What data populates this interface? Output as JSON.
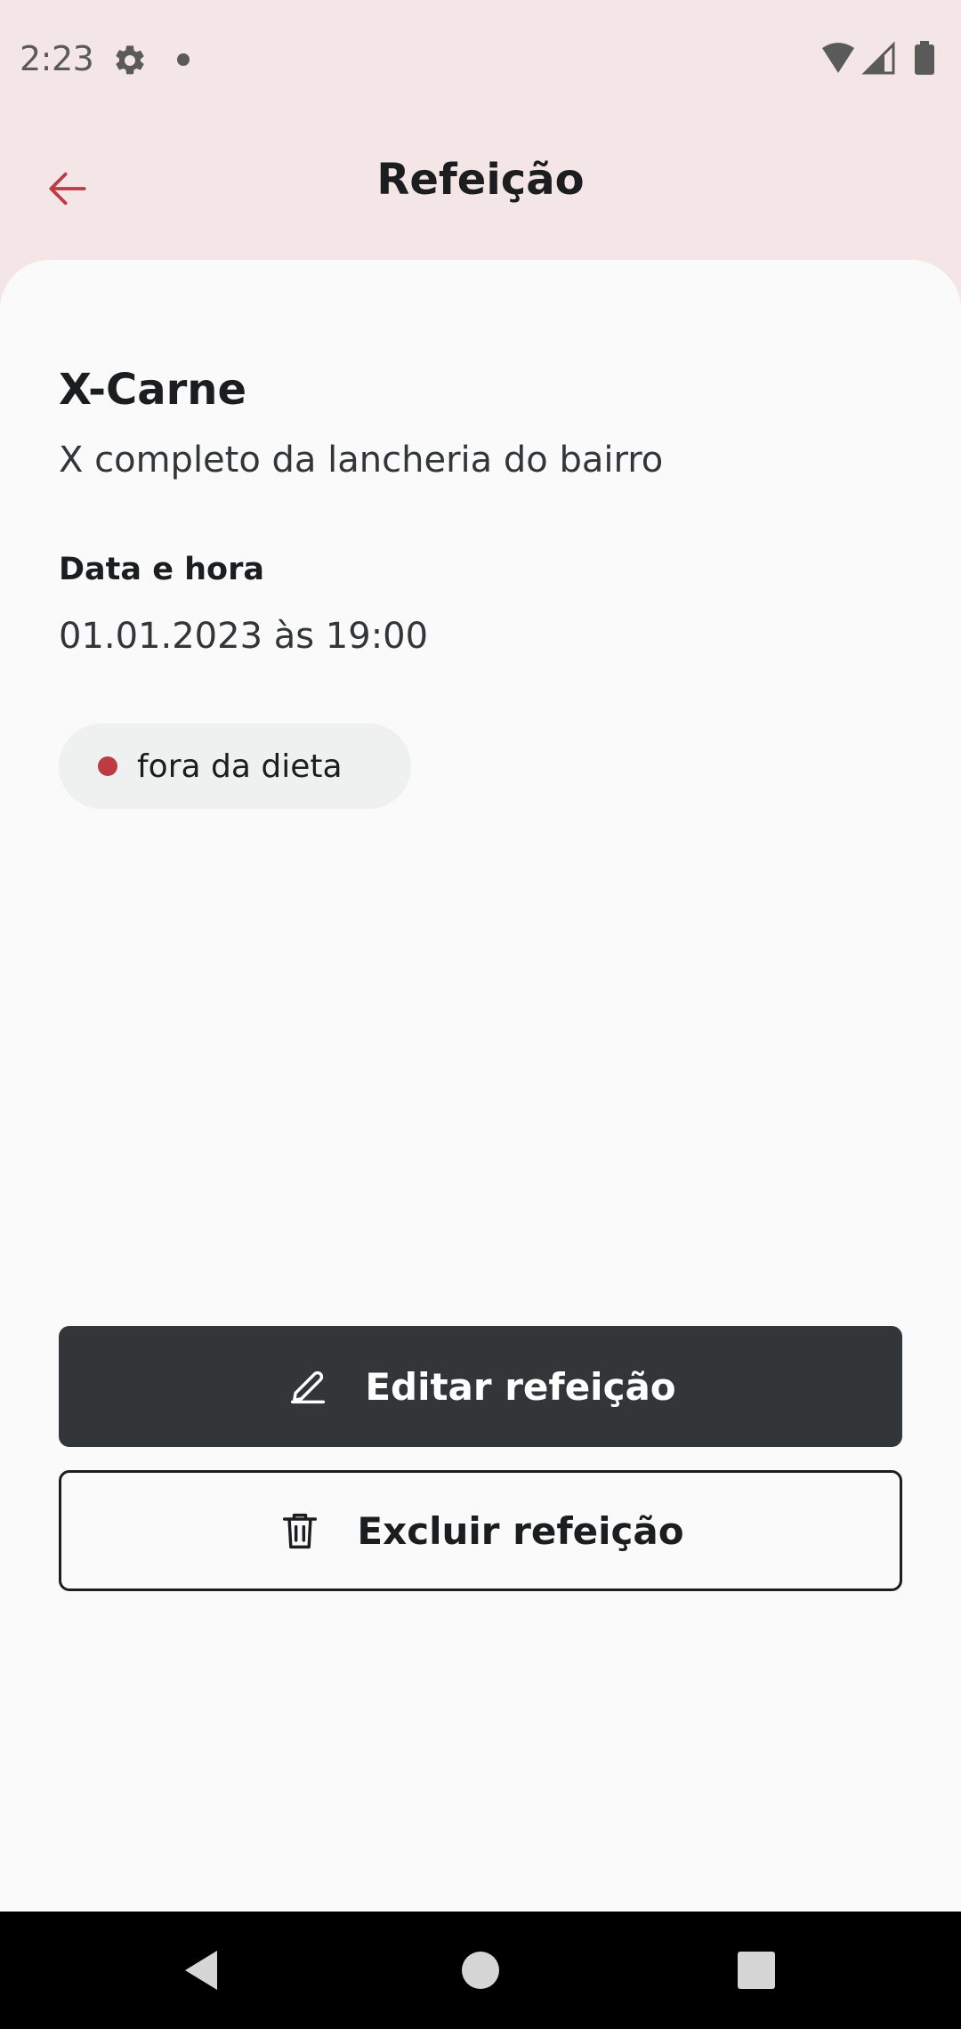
{
  "status_bar": {
    "time": "2:23",
    "icons": [
      "gear-icon",
      "notification-dot-icon",
      "wifi-icon",
      "signal-icon",
      "battery-icon"
    ]
  },
  "header": {
    "title": "Refeição",
    "back_icon": "arrow-left-icon",
    "accent_color": "#BF3B44"
  },
  "meal": {
    "name": "X-Carne",
    "description": "X completo da lancheria do bairro",
    "datetime_label": "Data e hora",
    "datetime_value": "01.01.2023 às 19:00",
    "status_tag": {
      "label": "fora da dieta",
      "dot_color": "#BF3B44"
    }
  },
  "actions": {
    "edit": {
      "label": "Editar refeição",
      "icon": "pencil-icon"
    },
    "delete": {
      "label": "Excluir refeição",
      "icon": "trash-icon"
    }
  },
  "nav_bar": {
    "icons": [
      "nav-back-icon",
      "nav-home-icon",
      "nav-recents-icon"
    ]
  },
  "colors": {
    "header_background": "#F4E5E6",
    "content_background": "#FAFAFA",
    "primary_button": "#333638",
    "tag_background": "#EFF0F0"
  }
}
